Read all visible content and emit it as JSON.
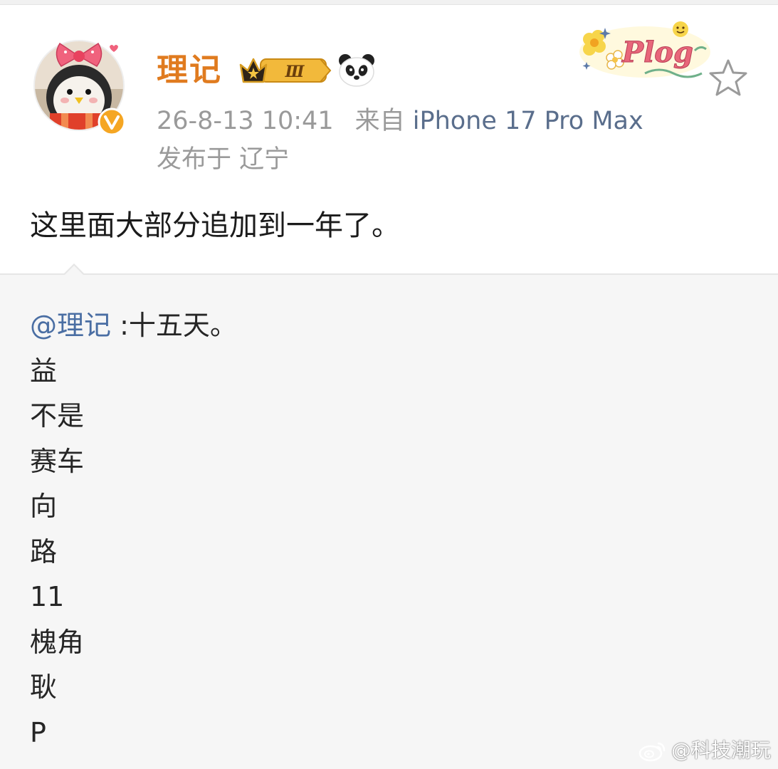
{
  "post": {
    "username": "理记",
    "level_badge": "Ⅲ",
    "timestamp": "26-8-13 10:41",
    "source_prefix": "来自",
    "device": "iPhone 17 Pro Max",
    "location": "发布于 辽宁",
    "text": "这里面大部分追加到一年了。",
    "decoration_text": "Plog"
  },
  "quote": {
    "mention": "@理记",
    "first_line_text": " :十五天。",
    "lines": [
      "益",
      "不是",
      "赛车",
      "向",
      "路",
      "11",
      "槐角",
      "耿",
      "P"
    ]
  },
  "watermark": {
    "text": "@科技潮玩"
  },
  "colors": {
    "username": "#e07b1f",
    "mention": "#4a6ea3",
    "meta": "#9a9a9a",
    "quote_background": "#f6f6f6"
  },
  "icons": {
    "verified": "verified-v-icon",
    "level": "crown-level-badge-icon",
    "panda": "panda-emoji-icon",
    "favorite": "star-outline-icon",
    "weibo": "weibo-logo-icon"
  }
}
